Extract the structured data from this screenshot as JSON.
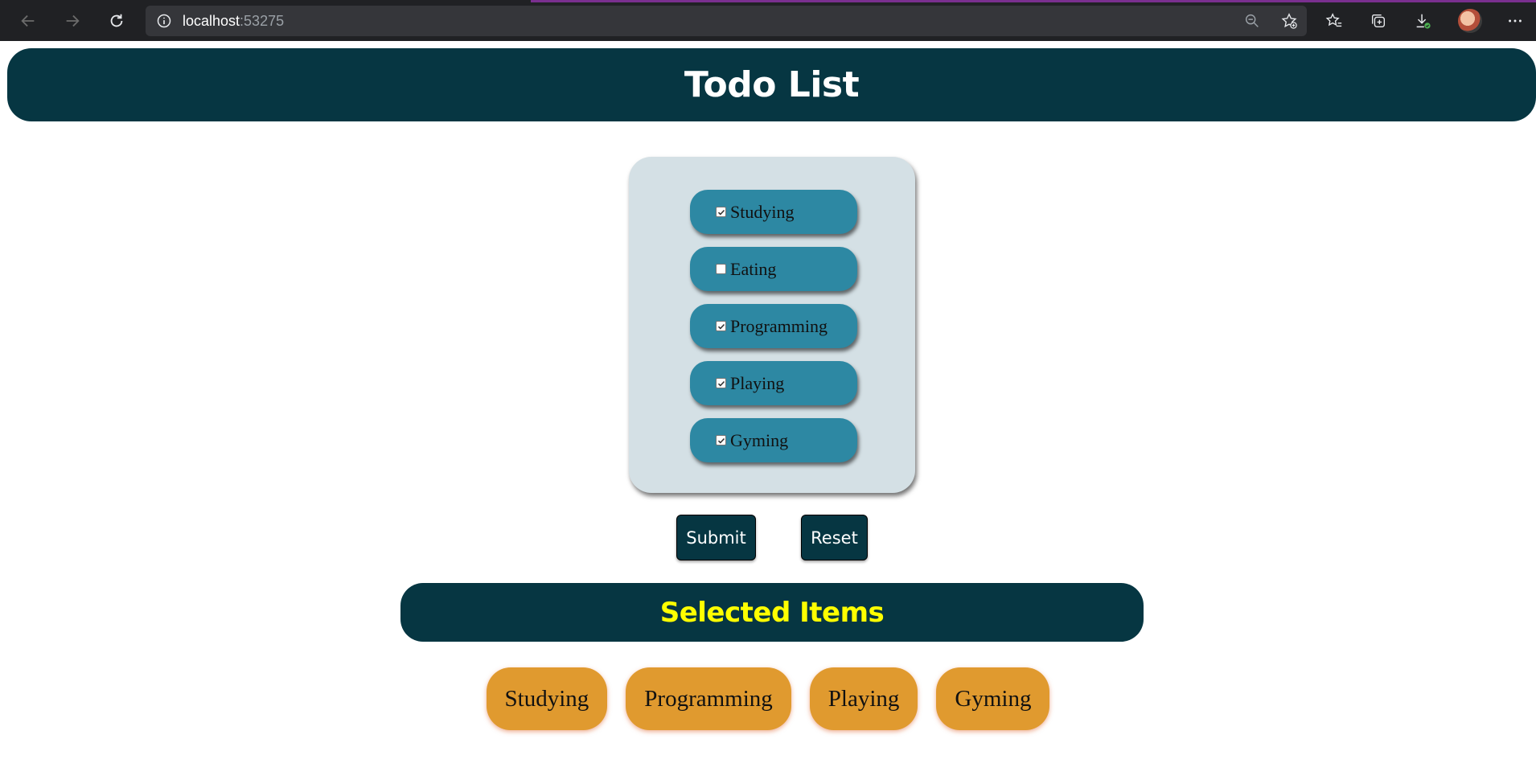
{
  "browser": {
    "url_host": "localhost",
    "url_port": ":53275",
    "accent_color": "#7a2f8f"
  },
  "page": {
    "title": "Todo List",
    "header_color": "#063642"
  },
  "todo_items": [
    {
      "label": "Studying",
      "checked": true
    },
    {
      "label": "Eating",
      "checked": false
    },
    {
      "label": "Programming",
      "checked": true
    },
    {
      "label": "Playing",
      "checked": true
    },
    {
      "label": "Gyming",
      "checked": true
    }
  ],
  "actions": {
    "submit_label": "Submit",
    "reset_label": "Reset"
  },
  "selected": {
    "title": "Selected Items",
    "title_color": "#ffff00",
    "chip_color": "#e09a2f",
    "items": [
      "Studying",
      "Programming",
      "Playing",
      "Gyming"
    ]
  }
}
